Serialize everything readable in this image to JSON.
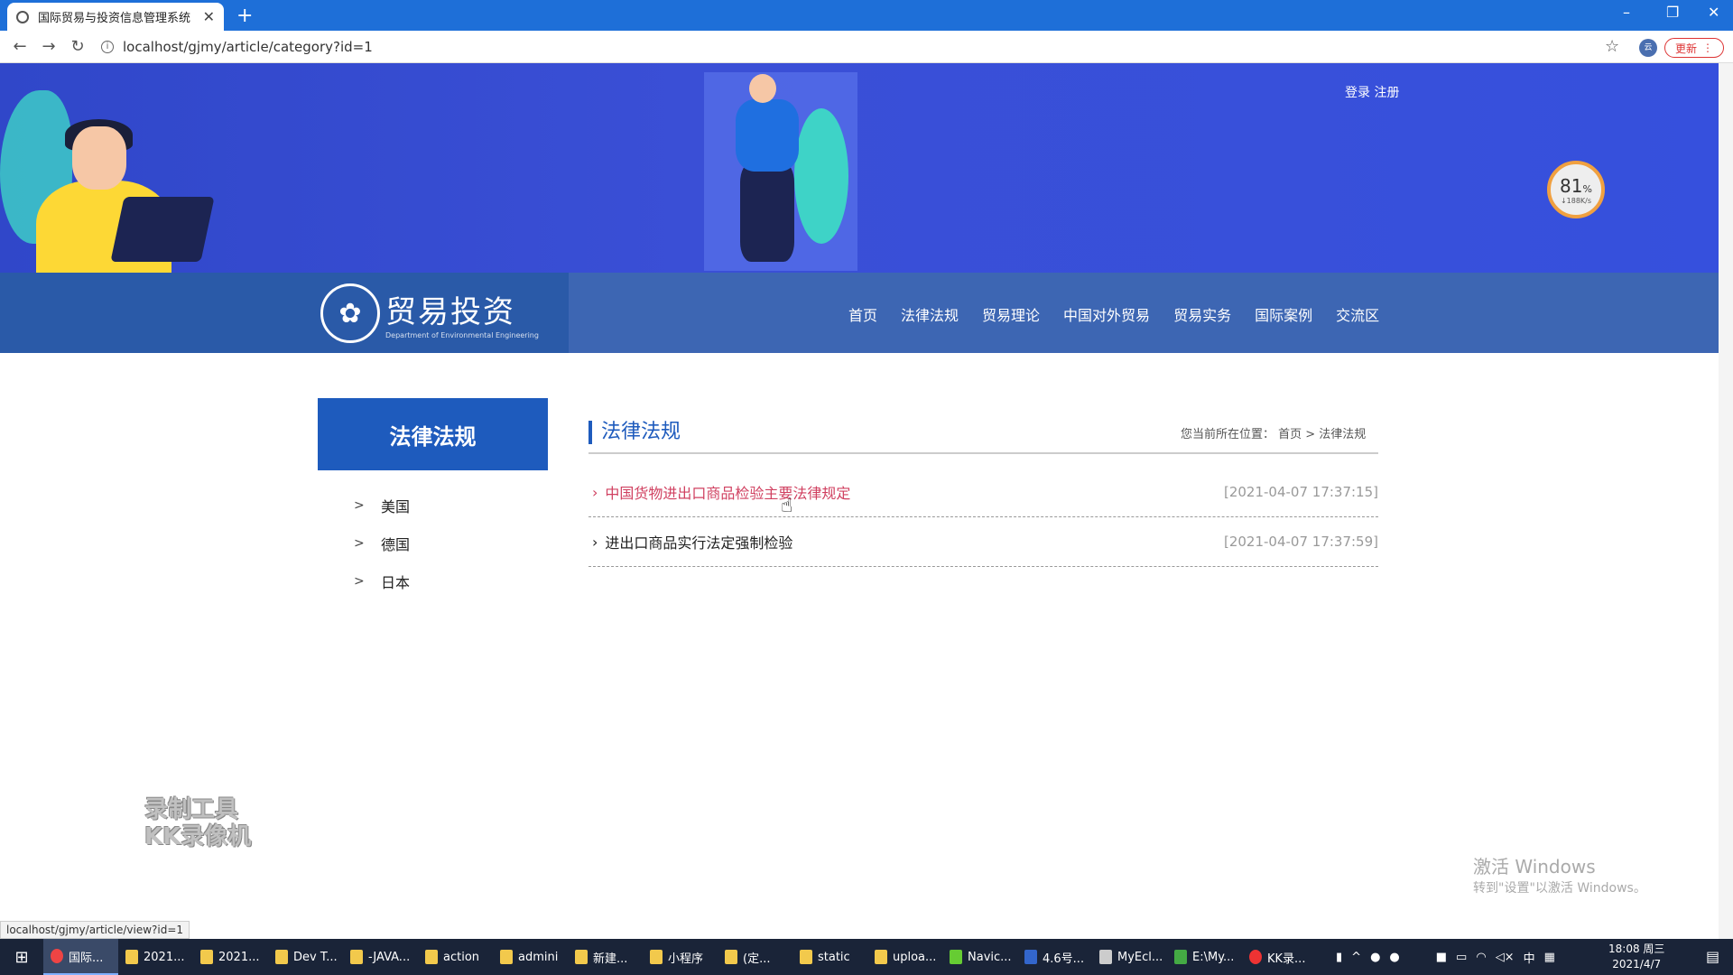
{
  "browser": {
    "tab_title": "国际贸易与投资信息管理系统",
    "url": "localhost/gjmy/article/category?id=1",
    "update_label": "更新",
    "status_url": "localhost/gjmy/article/view?id=1"
  },
  "header": {
    "login_links": "登录 注册",
    "logo_cn": "贸易投资",
    "logo_en": "Department of Environmental Engineering",
    "nav": [
      "首页",
      "法律法规",
      "贸易理论",
      "中国对外贸易",
      "贸易实务",
      "国际案例",
      "交流区"
    ]
  },
  "speed_badge": {
    "percent": "81",
    "unit": "%",
    "rate": "↓188K/s"
  },
  "sidebar": {
    "title": "法律法规",
    "items": [
      "美国",
      "德国",
      "日本"
    ]
  },
  "content": {
    "title": "法律法规",
    "breadcrumb": "您当前所在位置： 首页 > 法律法规",
    "articles": [
      {
        "title": "中国货物进出口商品检验主要法律规定",
        "date": "[2021-04-07 17:37:15]"
      },
      {
        "title": "进出口商品实行法定强制检验",
        "date": "[2021-04-07 17:37:59]"
      }
    ]
  },
  "overlay": {
    "record_tool_1": "录制工具",
    "record_tool_2": "KK录像机",
    "activate_1": "激活 Windows",
    "activate_2": "转到\"设置\"以激活 Windows。"
  },
  "taskbar": {
    "tasks": [
      "国际...",
      "2021...",
      "2021...",
      "Dev T...",
      "-JAVA...",
      "action",
      "admini",
      "新建...",
      "小程序",
      "(定...",
      "static",
      "uploa...",
      "Navic...",
      "4.6号...",
      "MyEcl...",
      "E:\\My...",
      "KK录..."
    ],
    "ime": "中",
    "time": "18:08 周三",
    "date": "2021/4/7"
  }
}
